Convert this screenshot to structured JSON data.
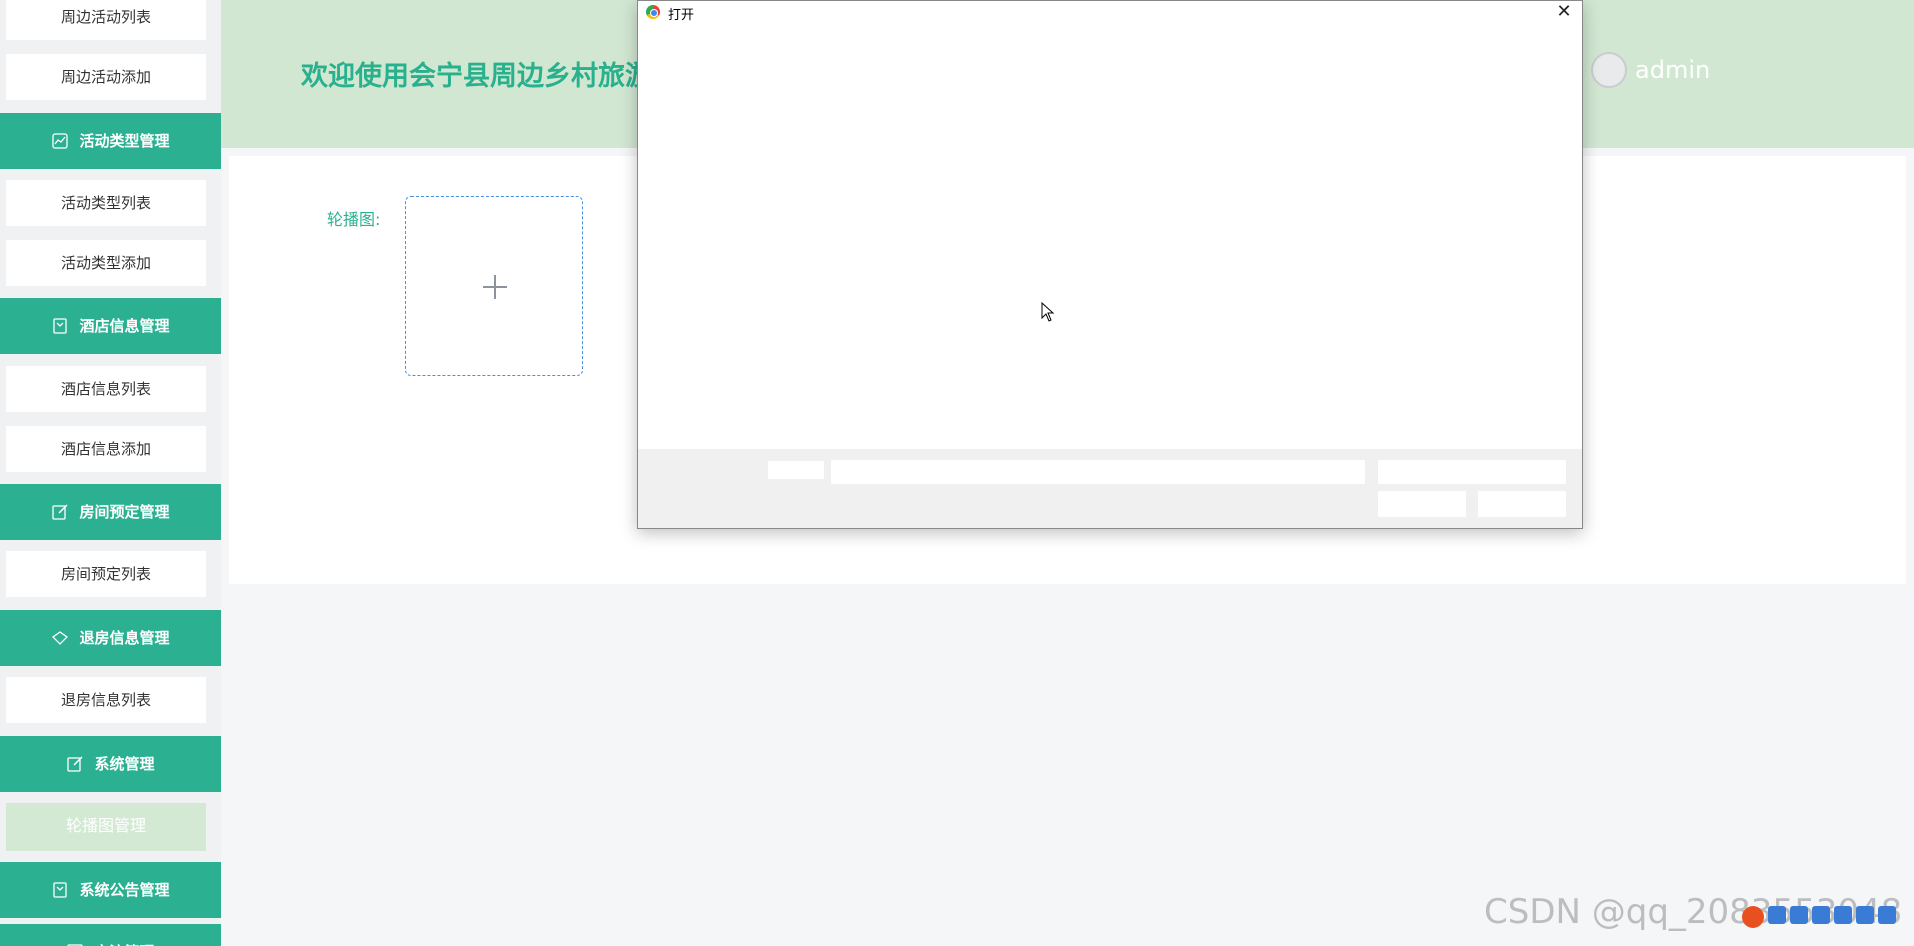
{
  "sidebar": {
    "items": [
      {
        "type": "sub",
        "label": "周边活动列表"
      },
      {
        "type": "sub",
        "label": "周边活动添加"
      },
      {
        "type": "group",
        "label": "活动类型管理",
        "icon": "chart-line-icon"
      },
      {
        "type": "sub",
        "label": "活动类型列表"
      },
      {
        "type": "sub",
        "label": "活动类型添加"
      },
      {
        "type": "group",
        "label": "酒店信息管理",
        "icon": "bookmark-icon"
      },
      {
        "type": "sub",
        "label": "酒店信息列表"
      },
      {
        "type": "sub",
        "label": "酒店信息添加"
      },
      {
        "type": "group",
        "label": "房间预定管理",
        "icon": "edit-icon"
      },
      {
        "type": "sub",
        "label": "房间预定列表"
      },
      {
        "type": "group",
        "label": "退房信息管理",
        "icon": "diamond-icon"
      },
      {
        "type": "sub",
        "label": "退房信息列表"
      },
      {
        "type": "group",
        "label": "系统管理",
        "icon": "edit-icon"
      },
      {
        "type": "sub",
        "label": "轮播图管理",
        "active": true
      },
      {
        "type": "group",
        "label": "系统公告管理",
        "icon": "bookmark-icon"
      },
      {
        "type": "group",
        "label": "交流管理",
        "icon": "check-square-icon"
      }
    ]
  },
  "header": {
    "welcome": "欢迎使用会宁县周边乡村旅游",
    "username": "admin"
  },
  "form": {
    "carousel_label": "轮播图:"
  },
  "dialog": {
    "title": "打开",
    "close": "✕"
  },
  "watermark": "CSDN @qq_2083553048",
  "colors": {
    "primary": "#2bb191",
    "header_bg": "#d1e7d2",
    "active_sub_bg": "#d3e9d4"
  }
}
